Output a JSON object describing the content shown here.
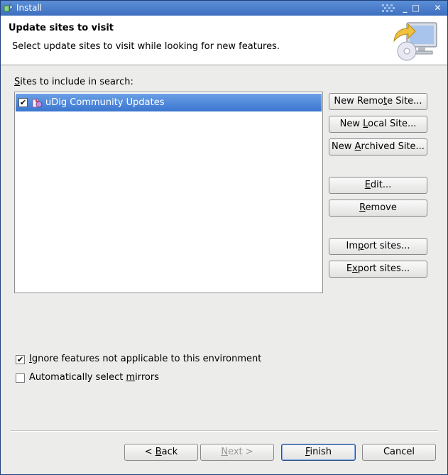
{
  "window": {
    "title": "Install",
    "controls": {
      "minimize": "_",
      "maximize": "□",
      "close": "✕"
    }
  },
  "header": {
    "title": "Update sites to visit",
    "description": "Select update sites to visit while looking for new features."
  },
  "sites": {
    "label_mnemonic": "S",
    "label_rest": "ites to include in search:",
    "items": [
      {
        "label": "uDig Community Updates",
        "checked": true,
        "selected": true,
        "icon": "update-site-icon"
      }
    ]
  },
  "side_buttons": {
    "new_remote": {
      "pre": "New Remo",
      "mn": "t",
      "post": "e Site..."
    },
    "new_local": {
      "pre": "New ",
      "mn": "L",
      "post": "ocal Site..."
    },
    "new_archived": {
      "pre": "New ",
      "mn": "A",
      "post": "rchived Site..."
    },
    "edit": {
      "pre": "",
      "mn": "E",
      "post": "dit..."
    },
    "remove": {
      "pre": "",
      "mn": "R",
      "post": "emove"
    },
    "import": {
      "pre": "Im",
      "mn": "p",
      "post": "ort sites..."
    },
    "export": {
      "pre": "E",
      "mn": "x",
      "post": "port sites..."
    }
  },
  "options": {
    "ignore": {
      "pre": "",
      "mn": "I",
      "post": "gnore features not applicable to this environment",
      "checked": true
    },
    "mirrors": {
      "pre": "Automatically select ",
      "mn": "m",
      "post": "irrors",
      "checked": false
    }
  },
  "footer": {
    "back": {
      "pre": "< ",
      "mn": "B",
      "post": "ack"
    },
    "next": {
      "pre": "",
      "mn": "N",
      "post": "ext >"
    },
    "finish": {
      "pre": "",
      "mn": "F",
      "post": "inish"
    },
    "cancel": "Cancel"
  },
  "colors": {
    "titlebar": "#4a7dcc",
    "selection": "#3b76cf",
    "window_bg": "#ececea"
  }
}
